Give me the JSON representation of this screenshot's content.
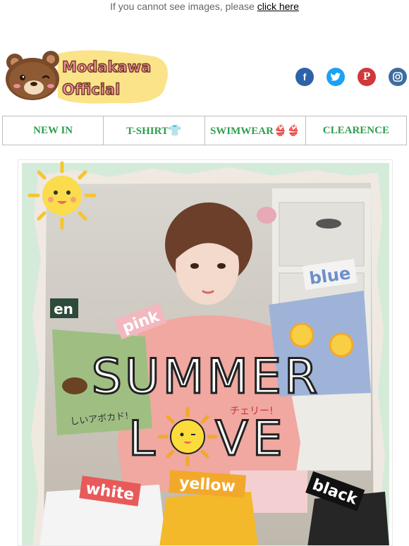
{
  "preheader": {
    "text": "If you cannot see images, please",
    "link_label": "click here"
  },
  "logo": {
    "line1": "Modakawa",
    "line2": "Official"
  },
  "social": {
    "icons": [
      "facebook-icon",
      "twitter-icon",
      "pinterest-icon",
      "instagram-icon"
    ],
    "colors": [
      "#2d62a8",
      "#1da1f2",
      "#d0383b",
      "#3d6d9e"
    ]
  },
  "nav": {
    "items": [
      {
        "label": "NEW IN"
      },
      {
        "label": "T-SHIRT👕"
      },
      {
        "label": "SWIMWEAR👙👙"
      },
      {
        "label": "CLEARENCE"
      }
    ]
  },
  "hero": {
    "headline_line1": "SUMMER",
    "headline_line2": "L",
    "headline_line2b": "VE",
    "tags": {
      "blue": "blue",
      "pink": "pink",
      "white": "white",
      "yellow": "yellow",
      "black": "black",
      "en": "en"
    },
    "shirt_text_green": "しいアボカド!",
    "shirt_text_pink": "チェリー!"
  },
  "colors": {
    "accent_green": "#2e9e4e"
  }
}
